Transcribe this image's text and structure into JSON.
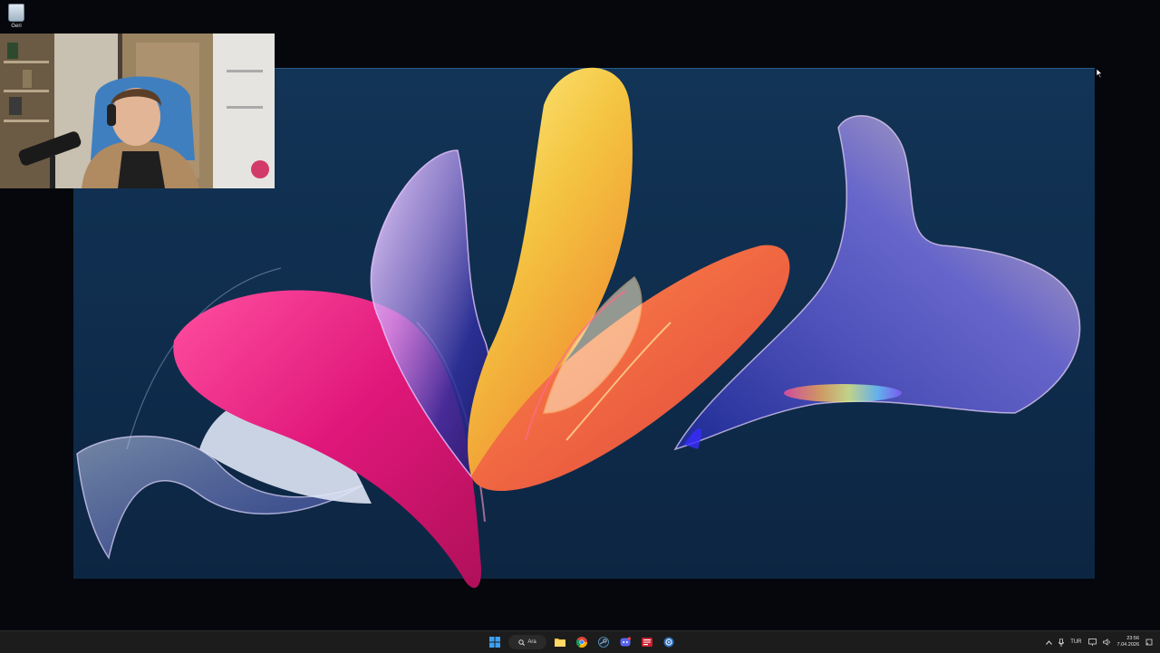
{
  "desktop": {
    "icons": [
      {
        "label": "Geri",
        "icon": "recycle-bin-icon"
      }
    ]
  },
  "taskbar": {
    "search_label": "Ara",
    "apps": [
      {
        "name": "start",
        "icon": "windows-start-icon"
      },
      {
        "name": "file-explorer",
        "icon": "folder-icon"
      },
      {
        "name": "chrome",
        "icon": "chrome-icon"
      },
      {
        "name": "steam",
        "icon": "steam-icon"
      },
      {
        "name": "discord",
        "icon": "discord-icon"
      },
      {
        "name": "media-app",
        "icon": "red-app-icon"
      },
      {
        "name": "settings-app",
        "icon": "blue-gear-icon"
      }
    ],
    "tray": {
      "language": "TUR",
      "time": "23:56",
      "date": "7.04.2026"
    }
  },
  "colors": {
    "taskbar_bg": "#1c1c1c",
    "wallpaper_bg": "#123456",
    "accent": "#0078d4"
  }
}
